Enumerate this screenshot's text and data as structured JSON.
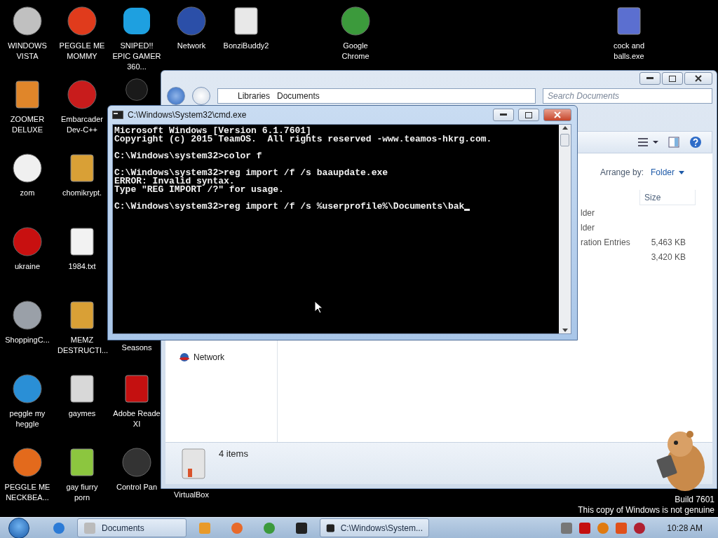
{
  "desktop": {
    "icons": [
      {
        "label": "WINDOWS VISTA"
      },
      {
        "label": "PEGGLE ME MOMMY"
      },
      {
        "label": "SNIPED!! EPIC GAMER 360..."
      },
      {
        "label": "Network"
      },
      {
        "label": "BonziBuddy2"
      },
      {
        "label": "Google Chrome"
      },
      {
        "label": "cock and balls.exe"
      },
      {
        "label": "ZOOMER DELUXE"
      },
      {
        "label": "Embarcader Dev-C++"
      },
      {
        "label": "zom"
      },
      {
        "label": "chomikrypt."
      },
      {
        "label": "ukraine"
      },
      {
        "label": "1984.txt"
      },
      {
        "label": "ShoppingC..."
      },
      {
        "label": "MEMZ DESTRUCTI..."
      },
      {
        "label": "Seasons"
      },
      {
        "label": "peggle my heggle"
      },
      {
        "label": "gaymes"
      },
      {
        "label": "Adobe Reade XI"
      },
      {
        "label": "PEGGLE ME NECKBEA..."
      },
      {
        "label": "gay fiurry porn"
      },
      {
        "label": "Control Pan"
      },
      {
        "label": "VirtualBox"
      }
    ]
  },
  "explorer": {
    "address": [
      "Libraries",
      "Documents"
    ],
    "search": {
      "placeholder": "Search Documents"
    },
    "arrange_label": "Arrange by:",
    "arrange_value": "Folder",
    "columns": [
      "Size"
    ],
    "rows": [
      {
        "type": "lder"
      },
      {
        "type": "lder"
      },
      {
        "type": "ration Entries",
        "size": "5,463 KB"
      },
      {
        "size": "3,420 KB"
      }
    ],
    "nav_items": [
      "Network"
    ],
    "status": "4 items"
  },
  "console": {
    "title": "C:\\Windows\\System32\\cmd.exe",
    "blocks": [
      [
        "Microsoft Windows [Version 6.1.7601]",
        "Copyright (c) 2015 TeamOS.  All rights reserved -www.teamos-hkrg.com."
      ],
      [
        "C:\\Windows\\system32>color f"
      ],
      [
        "C:\\Windows\\system32>reg import /f /s baaupdate.exe",
        "ERROR: Invalid syntax.",
        "Type \"REG IMPORT /?\" for usage."
      ],
      [
        "C:\\Windows\\system32>reg import /f /s %userprofile%\\Documents\\bak"
      ]
    ]
  },
  "taskbar": {
    "tasks": [
      "Documents",
      "C:\\Windows\\System..."
    ],
    "clock": "10:28 AM"
  },
  "notice": {
    "build": "Build 7601",
    "message": "This copy of Windows is not genuine"
  }
}
